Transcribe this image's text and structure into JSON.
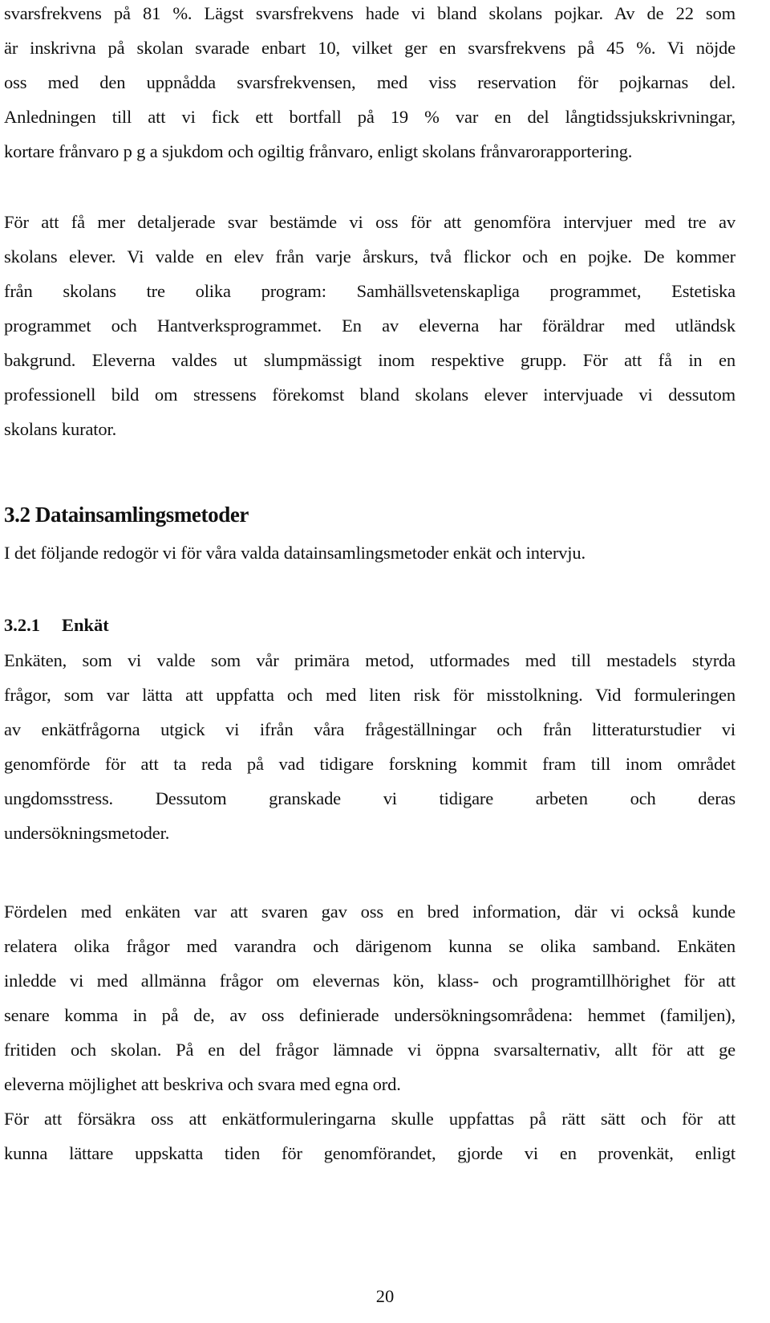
{
  "paragraphs": {
    "p1": [
      "svarsfrekvens på 81 %. Lägst svarsfrekvens hade vi bland skolans pojkar. Av de 22 som",
      "är inskrivna på skolan svarade enbart 10, vilket ger en svarsfrekvens på 45 %. Vi nöjde",
      "oss med den uppnådda svarsfrekvensen, med viss reservation för pojkarnas del.",
      "Anledningen till att vi fick ett bortfall på 19 % var en del långtidssjukskrivningar,",
      "kortare frånvaro p g a sjukdom och ogiltig frånvaro, enligt skolans frånvarorapportering."
    ],
    "p2": [
      "För att få mer detaljerade svar bestämde vi oss för att genomföra intervjuer med tre av",
      "skolans elever. Vi valde en elev från varje årskurs, två flickor och en pojke. De kommer",
      "från skolans tre olika program: Samhällsvetenskapliga programmet, Estetiska",
      "programmet och Hantverksprogrammet. En av eleverna har föräldrar med utländsk",
      "bakgrund. Eleverna valdes ut slumpmässigt inom respektive grupp. För att få in en",
      "professionell bild om stressens förekomst bland skolans elever intervjuade vi dessutom",
      "skolans kurator."
    ],
    "p3": [
      "I det följande redogör vi för våra valda datainsamlingsmetoder enkät och intervju."
    ],
    "p4": [
      "Enkäten, som vi valde som vår primära metod, utformades med till mestadels styrda",
      "frågor, som var lätta att uppfatta och med liten risk för misstolkning. Vid formuleringen",
      "av enkätfrågorna utgick vi ifrån våra frågeställningar och från litteraturstudier vi",
      "genomförde för att ta reda på vad tidigare forskning kommit fram till inom området",
      "ungdomsstress. Dessutom granskade vi tidigare arbeten och deras",
      "undersökningsmetoder."
    ],
    "p5": [
      "Fördelen med enkäten var att svaren gav oss en bred information, där vi också kunde",
      "relatera olika frågor med varandra och därigenom kunna se olika samband. Enkäten",
      "inledde vi med allmänna frågor om elevernas kön, klass- och programtillhörighet för att",
      "senare komma in på de, av oss definierade undersökningsområdena: hemmet (familjen),",
      "fritiden och skolan. På en del frågor lämnade vi öppna svarsalternativ, allt för att ge",
      "eleverna möjlighet att beskriva och svara med egna ord."
    ],
    "p6": [
      "För att försäkra oss att enkätformuleringarna skulle uppfattas på rätt sätt och för att",
      "kunna lättare uppskatta tiden för genomförandet, gjorde vi en provenkät, enligt"
    ]
  },
  "headings": {
    "section": "3.2 Datainsamlingsmetoder",
    "subsection_number": "3.2.1",
    "subsection_title": "Enkät"
  },
  "page_number": "20"
}
